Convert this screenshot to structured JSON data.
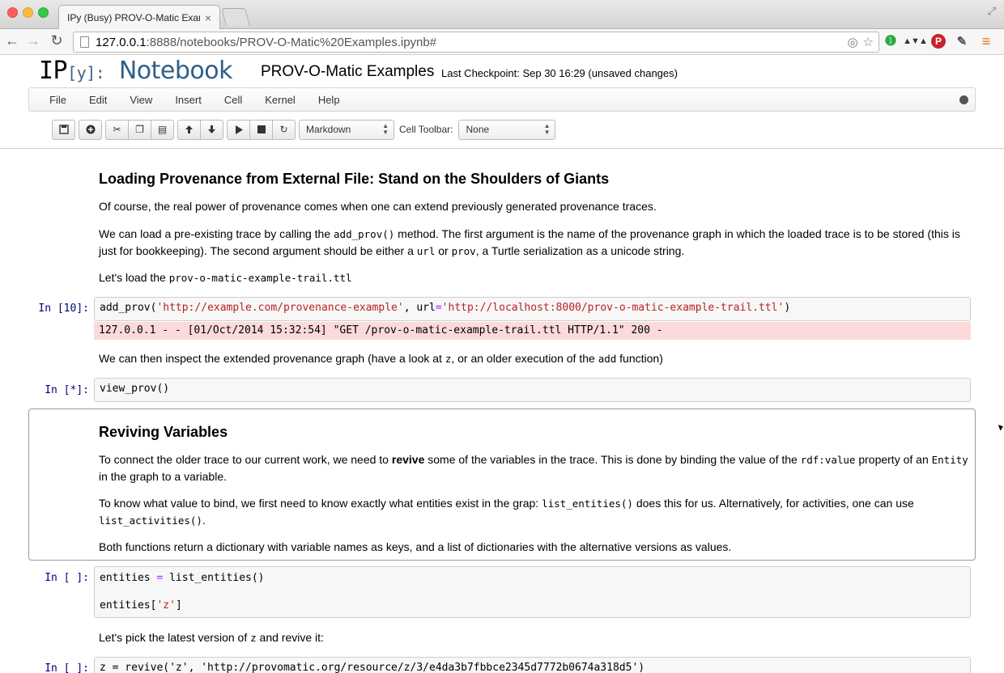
{
  "browser": {
    "tab_title": "IPy (Busy) PROV-O-Matic Examples",
    "tab_close": "×",
    "url_host": "127.0.0.1",
    "url_rest": ":8888/notebooks/PROV-O-Matic%20Examples.ipynb#"
  },
  "notebook": {
    "logo_ip": "IP",
    "logo_y": "[y]:",
    "logo_notebook": "Notebook",
    "title": "PROV-O-Matic Examples",
    "checkpoint": "Last Checkpoint: Sep 30 16:29 (unsaved changes)"
  },
  "menu": {
    "items": [
      "File",
      "Edit",
      "View",
      "Insert",
      "Cell",
      "Kernel",
      "Help"
    ]
  },
  "toolbar": {
    "cell_type": "Markdown",
    "cell_toolbar_label": "Cell Toolbar:",
    "cell_toolbar_value": "None"
  },
  "cells": {
    "h_loading": "Loading Provenance from External File: Stand on the Shoulders of Giants",
    "p1": "Of course, the real power of provenance comes when one can extend previously generated provenance traces.",
    "p2_a": "We can load a pre-existing trace by calling the ",
    "p2_code1": "add_prov()",
    "p2_b": " method. The first argument is the name of the provenance graph in which the loaded trace is to be stored (this is just for bookkeeping). The second argument should be either a ",
    "p2_code2": "url",
    "p2_c": " or ",
    "p2_code3": "prov",
    "p2_d": ", a Turtle serialization as a unicode string.",
    "p3_a": "Let's load the ",
    "p3_code": "prov-o-matic-example-trail.ttl",
    "in10_prompt": "In [10]:",
    "in10_fn": "add_prov(",
    "in10_s1": "'http://example.com/provenance-example'",
    "in10_mid": ", url",
    "in10_eq": "=",
    "in10_s2": "'http://localhost:8000/prov-o-matic-example-trail.ttl'",
    "in10_end": ")",
    "out10": "127.0.0.1 - - [01/Oct/2014 15:32:54] \"GET /prov-o-matic-example-trail.ttl HTTP/1.1\" 200 -",
    "p4_a": "We can then inspect the extended provenance graph (have a look at ",
    "p4_code1": "z",
    "p4_b": ", or an older execution of the ",
    "p4_code2": "add",
    "p4_c": " function)",
    "instar_prompt": "In [*]:",
    "instar_code": "view_prov()",
    "h_reviving": "Reviving Variables",
    "p5_a": "To connect the older trace to our current work, we need to ",
    "p5_bold": "revive",
    "p5_b": " some of the variables in the trace. This is done by binding the value of the ",
    "p5_code1": "rdf:value",
    "p5_c": " property of an ",
    "p5_code2": "Entity",
    "p5_d": " in the graph to a variable.",
    "p6_a": "To know what value to bind, we first need to know exactly what entities exist in the grap: ",
    "p6_code1": "list_entities()",
    "p6_b": " does this for us. Alternatively, for activities, one can use ",
    "p6_code2": "list_activities()",
    "p6_c": ".",
    "p7": "Both functions return a dictionary with variable names as keys, and a list of dictionaries with the alternative versions as values.",
    "inblank_prompt": "In [ ]:",
    "inblank_l1_a": "entities ",
    "inblank_l1_eq": "=",
    "inblank_l1_b": " list_entities()",
    "inblank_l2_a": "entities[",
    "inblank_l2_s": "'z'",
    "inblank_l2_b": "]",
    "p8_a": "Let's pick the latest version of ",
    "p8_code": "z",
    "p8_b": " and revive it:",
    "inlast_prompt": "In [ ]:",
    "inlast_code": "z = revive('z', 'http://provomatic.org/resource/z/3/e4da3b7fbbce2345d7772b0674a318d5')"
  }
}
